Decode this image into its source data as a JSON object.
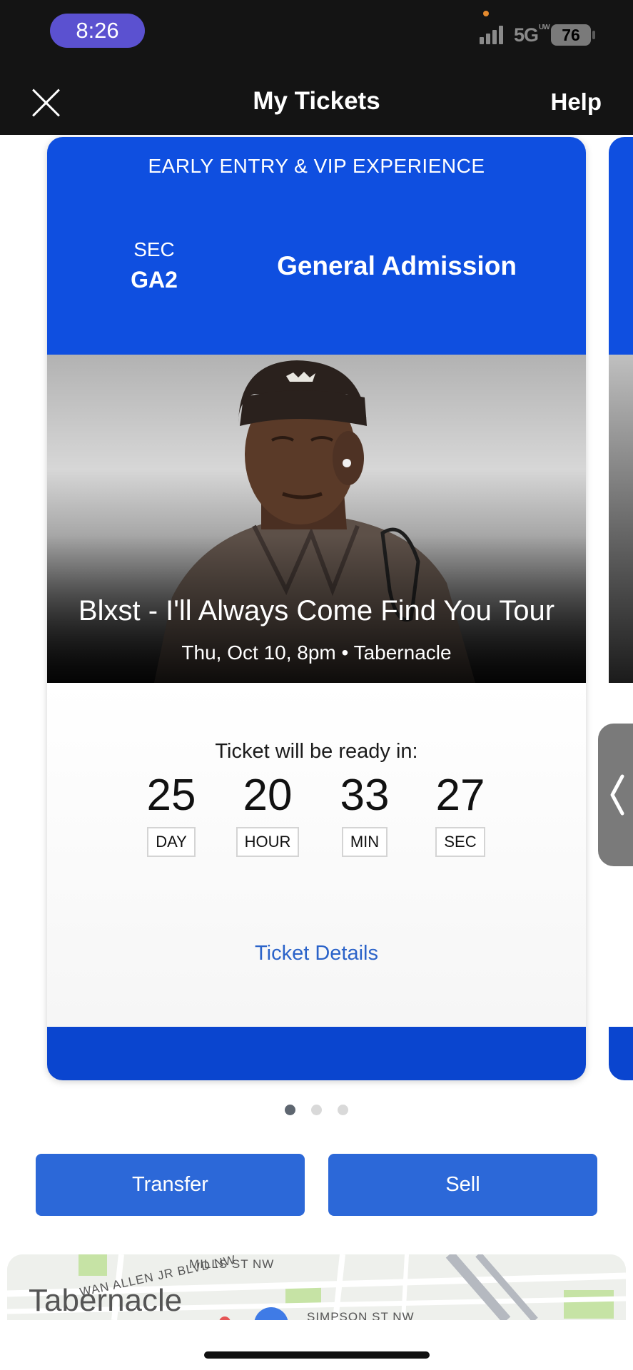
{
  "status_bar": {
    "time": "8:26",
    "network": "5G",
    "network_sup": "UW",
    "battery": "76"
  },
  "nav": {
    "title": "My Tickets",
    "help": "Help",
    "close_icon": "close-icon"
  },
  "ticket": {
    "banner": "EARLY ENTRY & VIP EXPERIENCE",
    "section_label": "SEC",
    "section_value": "GA2",
    "admission": "General Admission",
    "event_title": "Blxst - I'll Always Come Find You Tour",
    "event_meta": "Thu, Oct 10, 8pm • Tabernacle",
    "ready_text": "Ticket will be ready in:",
    "countdown": [
      {
        "value": "25",
        "unit": "DAY"
      },
      {
        "value": "20",
        "unit": "HOUR"
      },
      {
        "value": "33",
        "unit": "MIN"
      },
      {
        "value": "27",
        "unit": "SEC"
      }
    ],
    "details_link": "Ticket Details",
    "brand_color": "#0f4fe0"
  },
  "pager": {
    "count": 3,
    "active": 1
  },
  "actions": {
    "transfer": "Transfer",
    "sell": "Sell",
    "button_color": "#2c68d8"
  },
  "map": {
    "street_1": "MILLS ST NW",
    "street_2": "WAN ALLEN JR BLVD NW",
    "street_3": "SIMPSON ST NW",
    "venue": "Tabernacle"
  }
}
